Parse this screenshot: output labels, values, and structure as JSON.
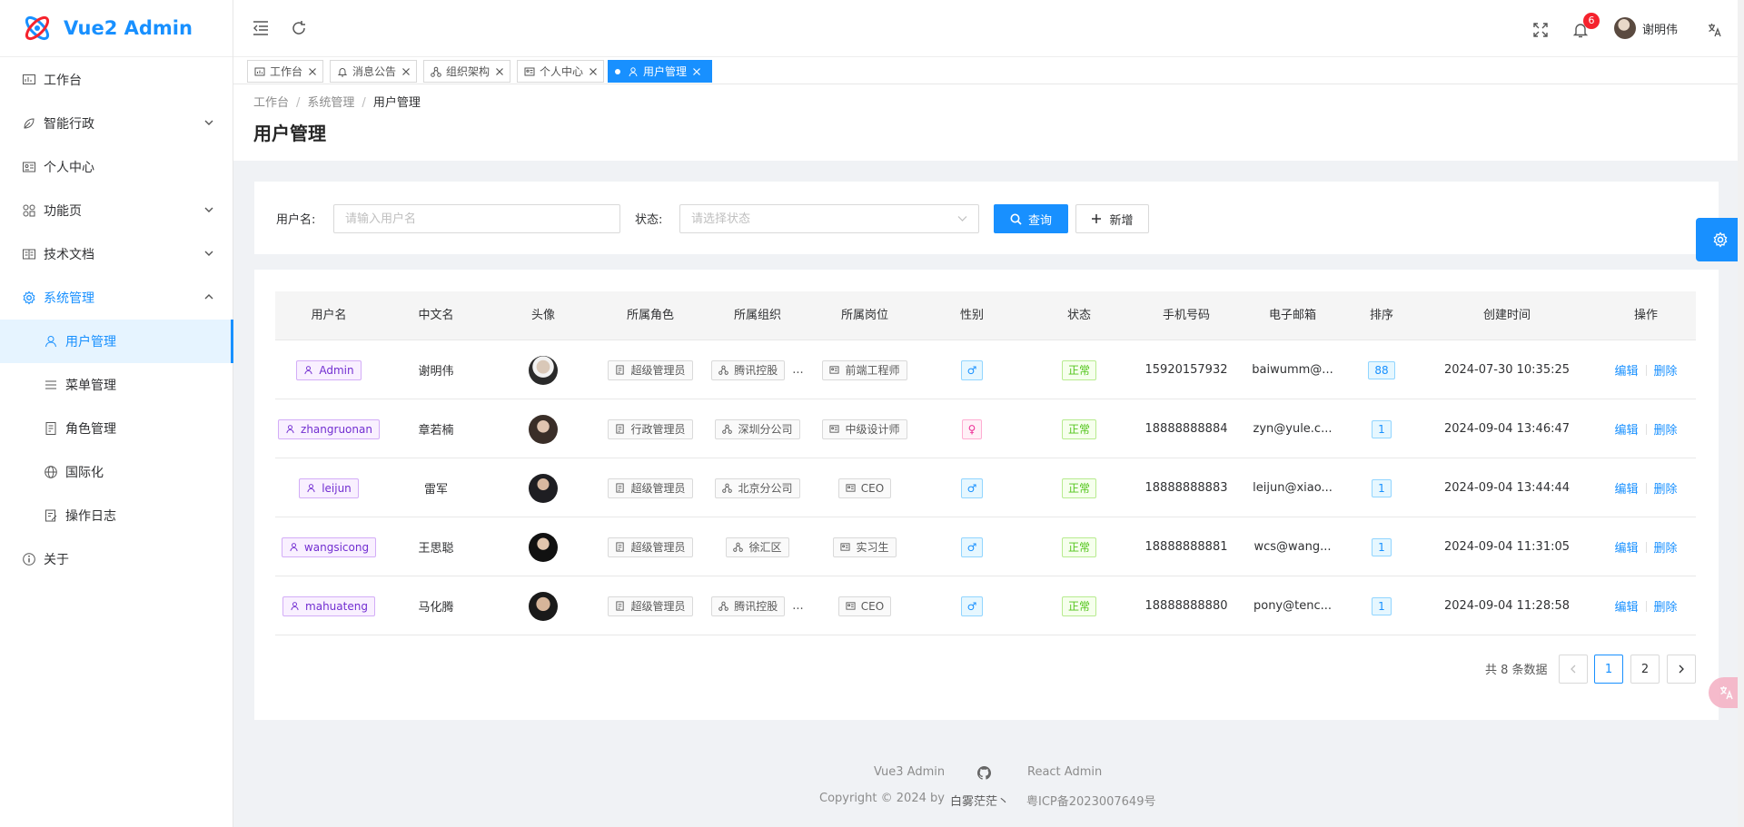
{
  "app": {
    "title": "Vue2 Admin",
    "accent": "#1890ff"
  },
  "sidebar": {
    "items": [
      {
        "label": "工作台",
        "icon": "dashboard-icon"
      },
      {
        "label": "智能行政",
        "icon": "leaf-icon"
      },
      {
        "label": "个人中心",
        "icon": "id-card-icon"
      },
      {
        "label": "功能页",
        "icon": "function-icon"
      },
      {
        "label": "技术文档",
        "icon": "doc-icon"
      },
      {
        "label": "系统管理",
        "icon": "gear-icon"
      },
      {
        "label": "用户管理",
        "icon": "user-icon"
      },
      {
        "label": "菜单管理",
        "icon": "menu-icon"
      },
      {
        "label": "角色管理",
        "icon": "role-icon"
      },
      {
        "label": "国际化",
        "icon": "globe-icon"
      },
      {
        "label": "操作日志",
        "icon": "log-icon"
      },
      {
        "label": "关于",
        "icon": "info-icon"
      }
    ]
  },
  "header": {
    "notification_count": "6",
    "username": "谢明伟"
  },
  "tabs": [
    {
      "label": "工作台",
      "icon": "dashboard-icon"
    },
    {
      "label": "消息公告",
      "icon": "bell-icon"
    },
    {
      "label": "组织架构",
      "icon": "org-icon"
    },
    {
      "label": "个人中心",
      "icon": "id-card-icon"
    },
    {
      "label": "用户管理",
      "icon": "user-icon"
    }
  ],
  "breadcrumb": [
    "工作台",
    "系统管理",
    "用户管理"
  ],
  "page_title": "用户管理",
  "search": {
    "username_label": "用户名:",
    "username_placeholder": "请输入用户名",
    "status_label": "状态:",
    "status_placeholder": "请选择状态",
    "query_button": "查询",
    "add_button": "新增"
  },
  "table": {
    "columns": [
      "用户名",
      "中文名",
      "头像",
      "所属角色",
      "所属组织",
      "所属岗位",
      "性别",
      "状态",
      "手机号码",
      "电子邮箱",
      "排序",
      "创建时间",
      "操作"
    ],
    "rows": [
      {
        "username": "Admin",
        "cn_name": "谢明伟",
        "role": "超级管理员",
        "org": "腾讯控股",
        "org_more": "...",
        "post": "前端工程师",
        "gender": "♂",
        "status": "正常",
        "phone": "15920157932",
        "email": "baiwumm@...",
        "sort": "88",
        "created": "2024-07-30 10:35:25"
      },
      {
        "username": "zhangruonan",
        "cn_name": "章若楠",
        "role": "行政管理员",
        "org": "深圳分公司",
        "org_more": "",
        "post": "中级设计师",
        "gender": "♀",
        "status": "正常",
        "phone": "18888888884",
        "email": "zyn@yule.c...",
        "sort": "1",
        "created": "2024-09-04 13:46:47"
      },
      {
        "username": "leijun",
        "cn_name": "雷军",
        "role": "超级管理员",
        "org": "北京分公司",
        "org_more": "",
        "post": "CEO",
        "gender": "♂",
        "status": "正常",
        "phone": "18888888883",
        "email": "leijun@xiao...",
        "sort": "1",
        "created": "2024-09-04 13:44:44"
      },
      {
        "username": "wangsicong",
        "cn_name": "王思聪",
        "role": "超级管理员",
        "org": "徐汇区",
        "org_more": "",
        "post": "实习生",
        "gender": "♂",
        "status": "正常",
        "phone": "18888888881",
        "email": "wcs@wang...",
        "sort": "1",
        "created": "2024-09-04 11:31:05"
      },
      {
        "username": "mahuateng",
        "cn_name": "马化腾",
        "role": "超级管理员",
        "org": "腾讯控股",
        "org_more": "...",
        "post": "CEO",
        "gender": "♂",
        "status": "正常",
        "phone": "18888888880",
        "email": "pony@tenc...",
        "sort": "1",
        "created": "2024-09-04 11:28:58"
      }
    ],
    "edit_label": "编辑",
    "delete_label": "删除"
  },
  "pagination": {
    "total_text": "共 8 条数据",
    "pages": [
      "1",
      "2"
    ],
    "current": "1"
  },
  "footer": {
    "links": [
      "Vue3 Admin",
      "React Admin"
    ],
    "copyright": "Copyright © 2024 by",
    "author": "白雾茫茫丶",
    "icp": "粤ICP备2023007649号"
  }
}
